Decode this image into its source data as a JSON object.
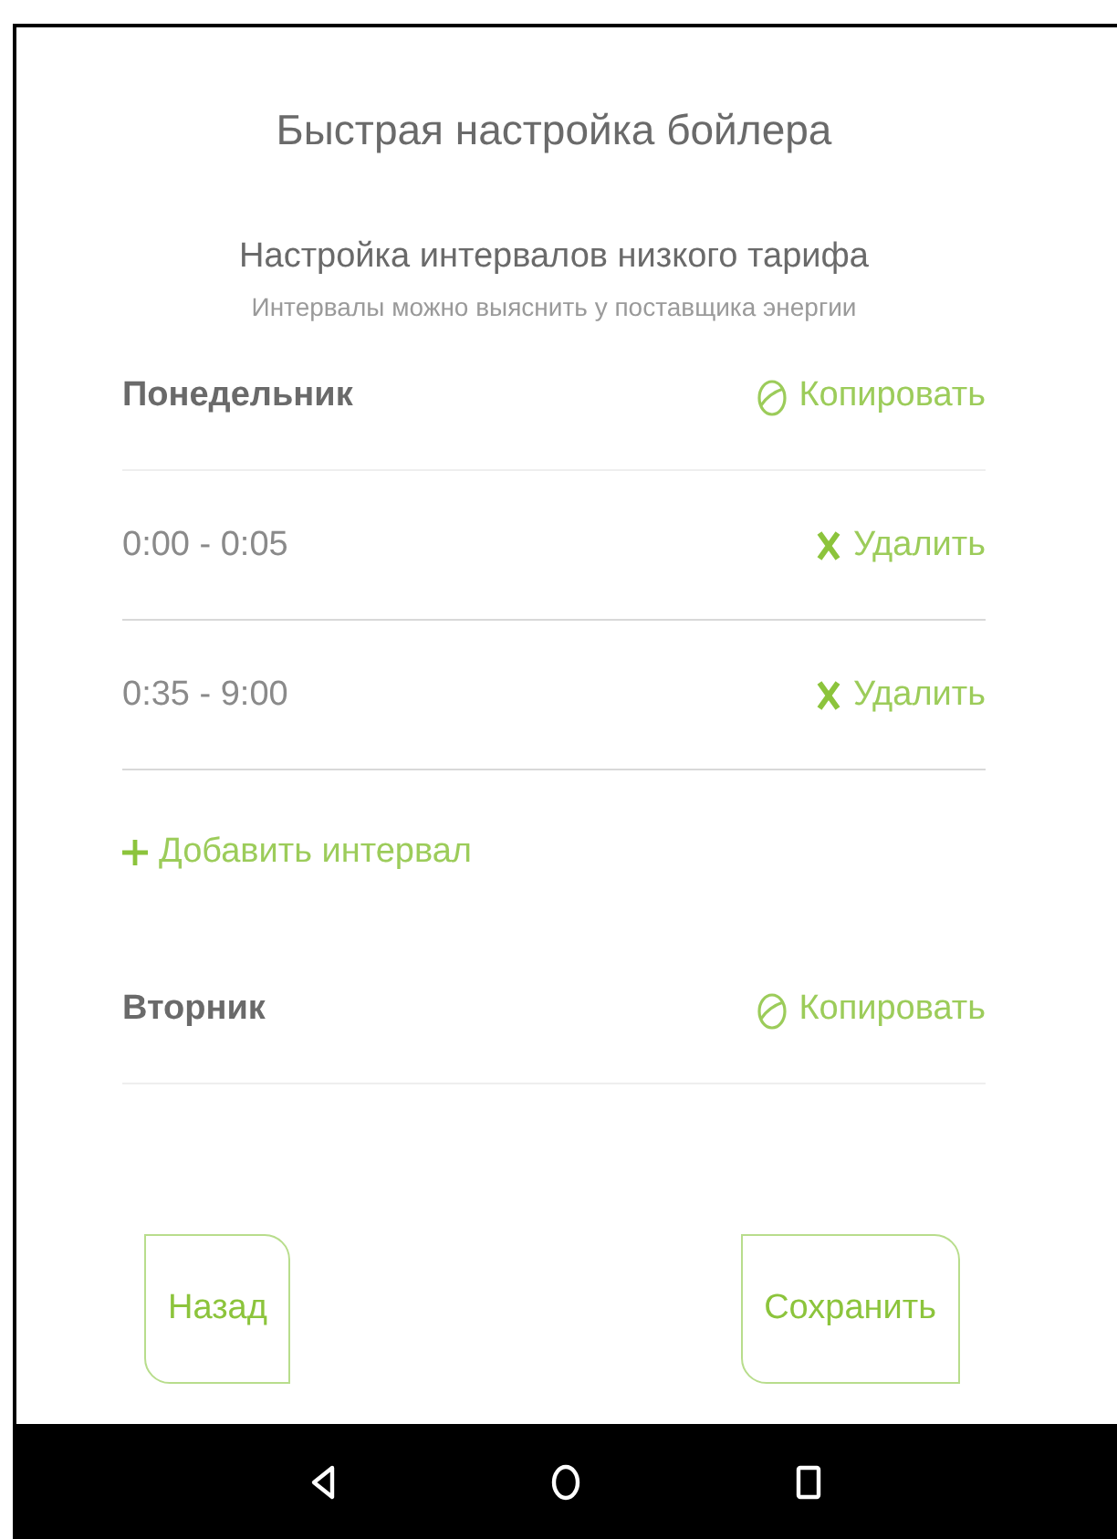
{
  "title": "Быстрая настройка бойлера",
  "subtitle": "Настройка интервалов низкого тарифа",
  "hint": "Интервалы можно выяснить у поставщика энергии",
  "days": [
    {
      "name": "Понедельник",
      "copy_label": "Копировать",
      "intervals": [
        {
          "time": "0:00 - 0:05",
          "delete_label": "Удалить"
        },
        {
          "time": "0:35 - 9:00",
          "delete_label": "Удалить"
        }
      ],
      "add_label": "Добавить интервал"
    },
    {
      "name": "Вторник",
      "copy_label": "Копировать"
    }
  ],
  "buttons": {
    "back": "Назад",
    "save": "Сохранить"
  }
}
